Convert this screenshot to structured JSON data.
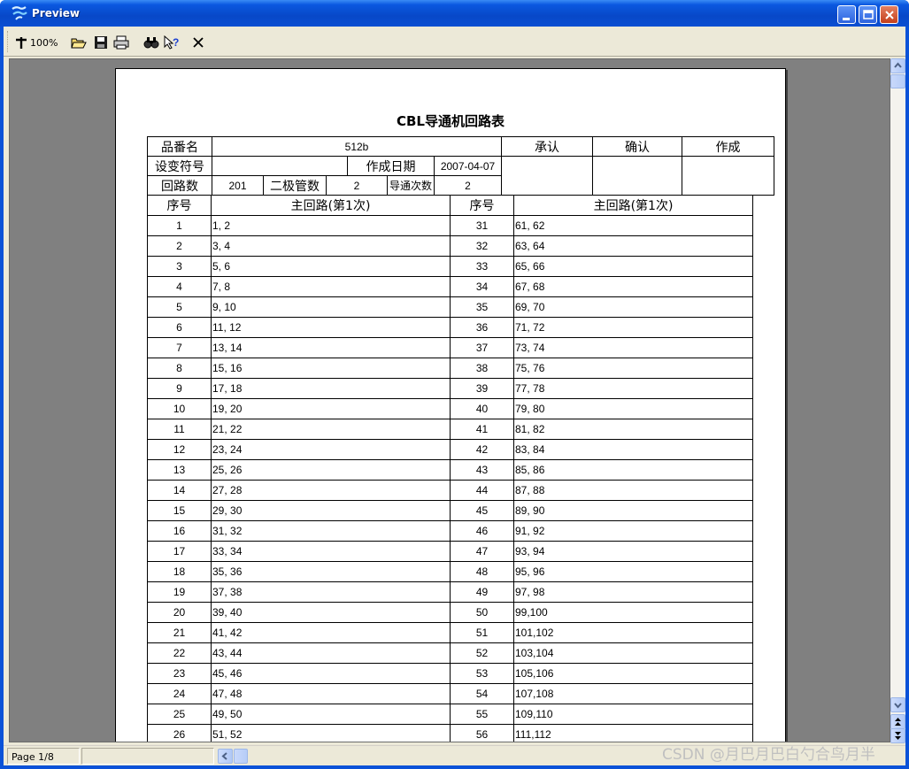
{
  "window": {
    "title": "Preview",
    "titlebar_color": "#0a4ed2"
  },
  "toolbar": {
    "zoom_label": "100%",
    "icons": [
      "magnify-icon",
      "open-folder-icon",
      "save-icon",
      "print-icon",
      "find-icon",
      "help-icon",
      "close-icon"
    ]
  },
  "document": {
    "title": "CBL导通机回路表",
    "header": {
      "product_label": "品番名",
      "product_value": "512b",
      "approve_label": "承认",
      "confirm_label": "确认",
      "create_label": "作成",
      "change_label": "设变符号",
      "change_value": "",
      "date_label": "作成日期",
      "date_value": "2007-04-07",
      "circuits_label": "回路数",
      "circuits_value": "201",
      "diodes_label": "二极管数",
      "diodes_value": "2",
      "conduction_label": "导通次数",
      "conduction_value": "2"
    },
    "columns": {
      "seq_left": "序号",
      "main_left": "主回路(第1次)",
      "seq_right": "序号",
      "main_right": "主回路(第1次)"
    },
    "rows": [
      {
        "l_no": "1",
        "l_pair": "1,  2",
        "r_no": "31",
        "r_pair": "61, 62"
      },
      {
        "l_no": "2",
        "l_pair": "3,  4",
        "r_no": "32",
        "r_pair": "63, 64"
      },
      {
        "l_no": "3",
        "l_pair": "5,  6",
        "r_no": "33",
        "r_pair": "65, 66"
      },
      {
        "l_no": "4",
        "l_pair": "7,  8",
        "r_no": "34",
        "r_pair": "67, 68"
      },
      {
        "l_no": "5",
        "l_pair": "9, 10",
        "r_no": "35",
        "r_pair": "69, 70"
      },
      {
        "l_no": "6",
        "l_pair": "11, 12",
        "r_no": "36",
        "r_pair": "71, 72"
      },
      {
        "l_no": "7",
        "l_pair": "13, 14",
        "r_no": "37",
        "r_pair": "73, 74"
      },
      {
        "l_no": "8",
        "l_pair": "15, 16",
        "r_no": "38",
        "r_pair": "75, 76"
      },
      {
        "l_no": "9",
        "l_pair": "17, 18",
        "r_no": "39",
        "r_pair": "77, 78"
      },
      {
        "l_no": "10",
        "l_pair": "19, 20",
        "r_no": "40",
        "r_pair": "79, 80"
      },
      {
        "l_no": "11",
        "l_pair": "21, 22",
        "r_no": "41",
        "r_pair": "81, 82"
      },
      {
        "l_no": "12",
        "l_pair": "23, 24",
        "r_no": "42",
        "r_pair": "83, 84"
      },
      {
        "l_no": "13",
        "l_pair": "25, 26",
        "r_no": "43",
        "r_pair": "85, 86"
      },
      {
        "l_no": "14",
        "l_pair": "27, 28",
        "r_no": "44",
        "r_pair": "87, 88"
      },
      {
        "l_no": "15",
        "l_pair": "29, 30",
        "r_no": "45",
        "r_pair": "89, 90"
      },
      {
        "l_no": "16",
        "l_pair": "31, 32",
        "r_no": "46",
        "r_pair": "91, 92"
      },
      {
        "l_no": "17",
        "l_pair": "33, 34",
        "r_no": "47",
        "r_pair": "93, 94"
      },
      {
        "l_no": "18",
        "l_pair": "35, 36",
        "r_no": "48",
        "r_pair": "95, 96"
      },
      {
        "l_no": "19",
        "l_pair": "37, 38",
        "r_no": "49",
        "r_pair": "97, 98"
      },
      {
        "l_no": "20",
        "l_pair": "39, 40",
        "r_no": "50",
        "r_pair": "99,100"
      },
      {
        "l_no": "21",
        "l_pair": "41, 42",
        "r_no": "51",
        "r_pair": "101,102"
      },
      {
        "l_no": "22",
        "l_pair": "43, 44",
        "r_no": "52",
        "r_pair": "103,104"
      },
      {
        "l_no": "23",
        "l_pair": "45, 46",
        "r_no": "53",
        "r_pair": "105,106"
      },
      {
        "l_no": "24",
        "l_pair": "47, 48",
        "r_no": "54",
        "r_pair": "107,108"
      },
      {
        "l_no": "25",
        "l_pair": "49, 50",
        "r_no": "55",
        "r_pair": "109,110"
      },
      {
        "l_no": "26",
        "l_pair": "51, 52",
        "r_no": "56",
        "r_pair": "111,112"
      }
    ]
  },
  "status": {
    "page": "Page 1/8"
  },
  "watermark": "CSDN @月巴月巴白勺合鸟月半"
}
